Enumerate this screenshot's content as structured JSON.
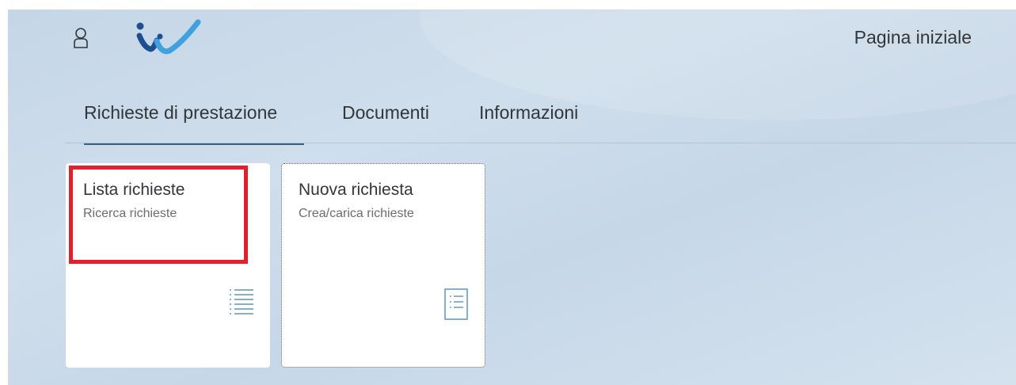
{
  "header": {
    "user_icon": "user-icon",
    "logo": "checkmark-logo",
    "home_label": "Pagina iniziale"
  },
  "tabs": [
    {
      "label": "Richieste di prestazione",
      "active": true
    },
    {
      "label": "Documenti",
      "active": false
    },
    {
      "label": "Informazioni",
      "active": false
    }
  ],
  "tiles": [
    {
      "title": "Lista richieste",
      "subtitle": "Ricerca richieste",
      "icon": "list-icon",
      "highlighted": true
    },
    {
      "title": "Nuova richiesta",
      "subtitle": "Crea/carica richieste",
      "icon": "form-document-icon",
      "focused": true
    }
  ],
  "colors": {
    "background": "#c9d9e9",
    "tab_underline": "#346187",
    "highlight_box": "#e0202d",
    "icon_blue": "#4a7fb5"
  }
}
